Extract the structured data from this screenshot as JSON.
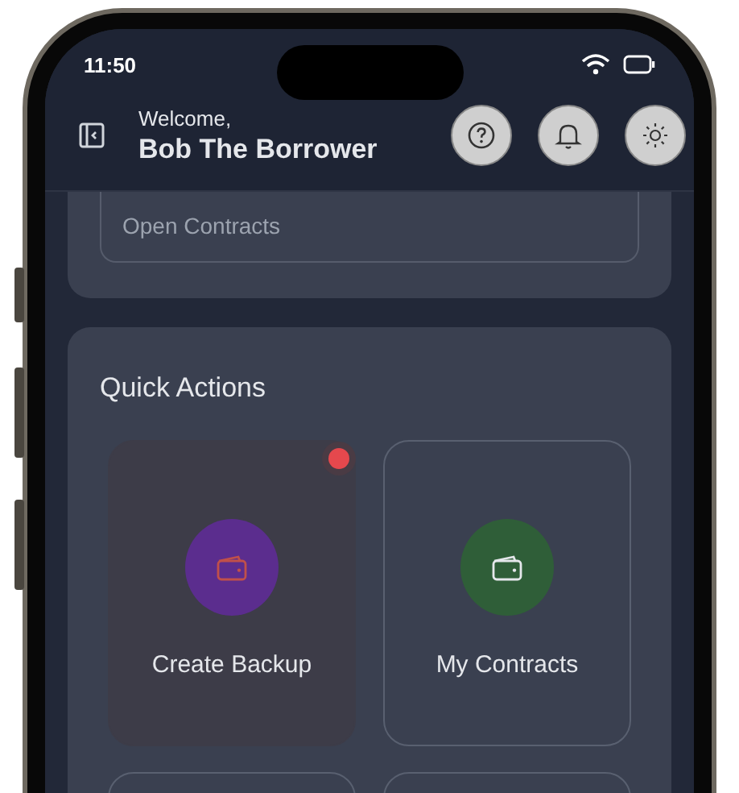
{
  "status_bar": {
    "time": "11:50"
  },
  "header": {
    "greeting": "Welcome,",
    "user_name": "Bob The Borrower"
  },
  "open_contracts": {
    "label": "Open Contracts"
  },
  "quick_actions": {
    "title": "Quick Actions",
    "actions": [
      {
        "label": "Create Backup",
        "selected": true,
        "badge": true,
        "color": "#5b2d8e"
      },
      {
        "label": "My Contracts",
        "selected": false,
        "badge": false,
        "color": "#2f5e38"
      }
    ]
  }
}
